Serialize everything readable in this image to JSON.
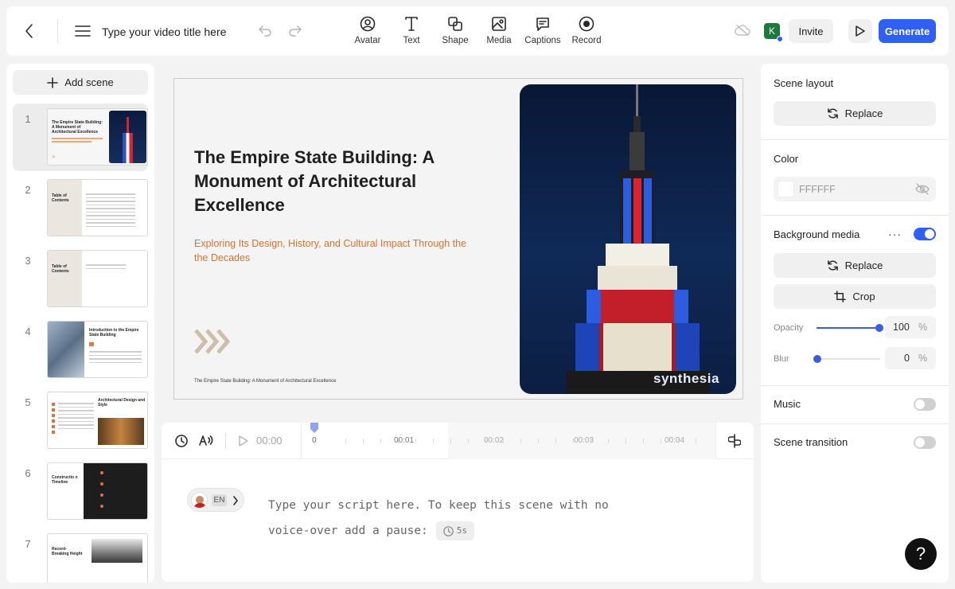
{
  "topbar": {
    "title_placeholder": "Type your video title here",
    "tools": [
      "Avatar",
      "Text",
      "Shape",
      "Media",
      "Captions",
      "Record"
    ],
    "avatar_initial": "K",
    "invite_label": "Invite",
    "generate_label": "Generate",
    "accent": "#2f5ff5"
  },
  "sidebar": {
    "add_scene_label": "Add scene",
    "scenes": [
      {
        "num": "1",
        "title": "The Empire State Building: A Monument of Architectural Excellence"
      },
      {
        "num": "2",
        "title": "Table of Contents"
      },
      {
        "num": "3",
        "title": "Table of Contents"
      },
      {
        "num": "4",
        "title": "Introduction to the Empire State Building"
      },
      {
        "num": "5",
        "title": "Architectural Design and Style"
      },
      {
        "num": "6",
        "title": "Constructio n Timeline"
      },
      {
        "num": "7",
        "title": "Record-Breaking Height"
      }
    ]
  },
  "slide": {
    "title": "The Empire State Building: A Monument of Architectural Excellence",
    "subtitle": "Exploring Its Design, History, and Cultural Impact Through the the Decades",
    "footer": "The Empire State Building: A Monument of Architectural Excellence",
    "watermark": "synthesia",
    "subtitle_color": "#e0702a"
  },
  "timeline": {
    "current_time": "00:00",
    "ticks": [
      "0",
      "00:01",
      "00:02",
      "00:03",
      "00:04"
    ]
  },
  "script": {
    "language": "EN",
    "text_line1": "Type your script here. To keep this scene with no",
    "text_line2": "voice-over add a pause:",
    "pause_label": "5s"
  },
  "properties": {
    "scene_layout_label": "Scene layout",
    "replace_label": "Replace",
    "color_label": "Color",
    "color_value": "FFFFFF",
    "background_media_label": "Background media",
    "background_media_on": true,
    "crop_label": "Crop",
    "opacity_label": "Opacity",
    "opacity_value": "100",
    "blur_label": "Blur",
    "blur_value": "0",
    "percent": "%",
    "music_label": "Music",
    "music_on": false,
    "transition_label": "Scene transition",
    "transition_on": false
  },
  "help_label": "?"
}
